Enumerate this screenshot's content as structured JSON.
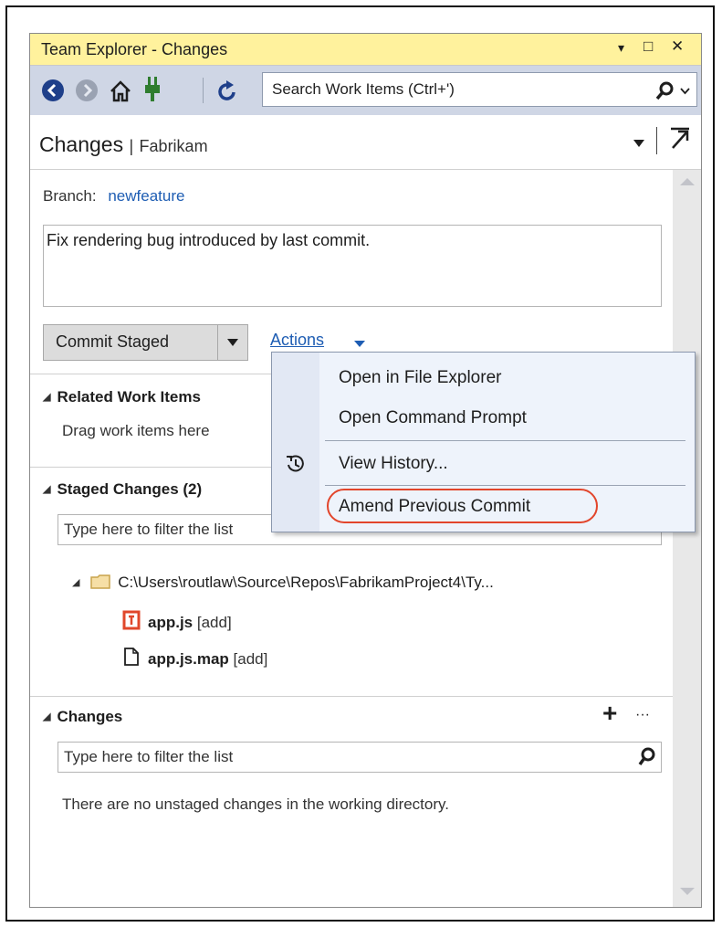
{
  "window": {
    "title": "Team Explorer - Changes",
    "controls": [
      "▾",
      "□",
      "✕"
    ]
  },
  "toolbar": {
    "buttons": [
      "back-icon",
      "forward-icon",
      "home-icon",
      "connect-icon",
      "refresh-icon"
    ],
    "search_placeholder": "Search Work Items (Ctrl+')"
  },
  "header": {
    "title": "Changes",
    "separator": "|",
    "repo": "Fabrikam"
  },
  "branch": {
    "label": "Branch:",
    "name": "newfeature"
  },
  "commit_message": "Fix rendering bug introduced by last commit.",
  "commit_button": {
    "label": "Commit Staged",
    "dropdown": "▾"
  },
  "actions_link": "Actions",
  "related": {
    "title": "Related Work Items",
    "hint": "Drag work items here"
  },
  "staged": {
    "title": "Staged Changes (2)",
    "filter_placeholder": "Type here to filter the list",
    "folder": "C:\\Users\\routlaw\\Source\\Repos\\FabrikamProject4\\Ty...",
    "files": [
      {
        "name": "app.js",
        "tag": "[add]"
      },
      {
        "name": "app.js.map",
        "tag": "[add]"
      }
    ]
  },
  "changes": {
    "title": "Changes",
    "add": "+",
    "more": "···",
    "filter_placeholder": "Type here to filter the list",
    "empty_message": "There are no unstaged changes in the working directory."
  },
  "menu": {
    "items": [
      "Open in File Explorer",
      "Open Command Prompt",
      "View History...",
      "Amend Previous Commit"
    ],
    "highlight_color": "#e2452b"
  },
  "colors": {
    "title_bar": "#fff29d",
    "toolbar": "#cfd6e5",
    "link": "#1e5db3"
  }
}
